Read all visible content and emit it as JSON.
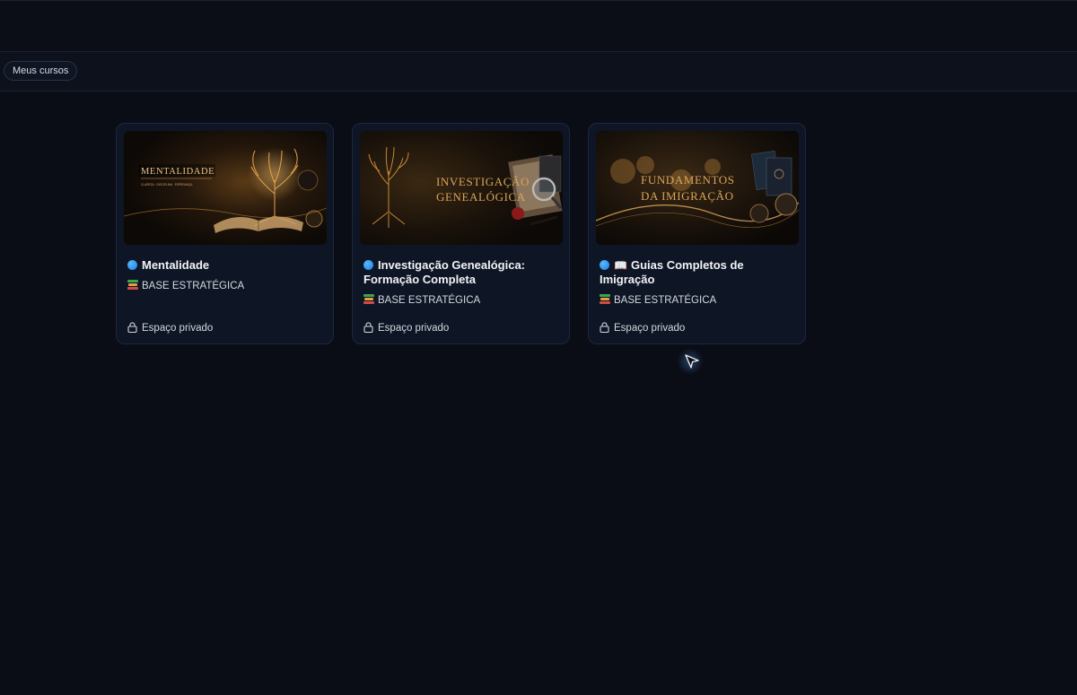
{
  "nav": {
    "chip_label": "Meus cursos"
  },
  "courses": [
    {
      "title": "Mentalidade",
      "has_book_emoji": false,
      "tag": "BASE ESTRATÉGICA",
      "access": "Espaço privado",
      "thumb_text": [
        "MENTALIDADE"
      ],
      "thumb_subtext": "CLAREZA · DISCIPLINA · ESPERANÇA"
    },
    {
      "title": "Investigação Genealógica: Formação Completa",
      "has_book_emoji": false,
      "tag": "BASE ESTRATÉGICA",
      "access": "Espaço privado",
      "thumb_text": [
        "INVESTIGAÇÃO",
        "GENEALÓGICA"
      ]
    },
    {
      "title": "Guias Completos de Imigração",
      "has_book_emoji": true,
      "book_emoji": "📖",
      "tag": "BASE ESTRATÉGICA",
      "access": "Espaço privado",
      "thumb_text": [
        "FUNDAMENTOS",
        "DA IMIGRAÇÃO"
      ]
    }
  ],
  "colors": {
    "background": "#0a0d15",
    "card": "#0e1524",
    "accent_dot": "#1a7fe0",
    "gold": "#d9a45a"
  },
  "icons": [
    "blue-circle-icon",
    "books-icon",
    "open-book-icon",
    "lock-icon",
    "mouse-cursor-icon"
  ]
}
